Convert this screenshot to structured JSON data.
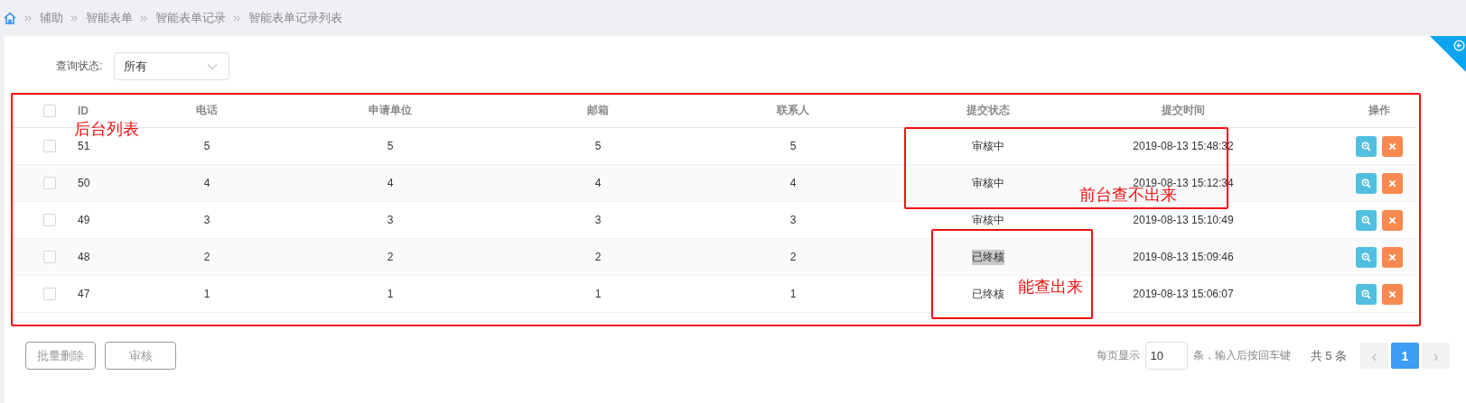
{
  "breadcrumb": [
    "辅助",
    "智能表单",
    "智能表单记录",
    "智能表单记录列表"
  ],
  "filter": {
    "label": "查询状态:",
    "value": "所有"
  },
  "table": {
    "all_checked": false,
    "columns": [
      "ID",
      "电话",
      "申请单位",
      "邮箱",
      "联系人",
      "提交状态",
      "提交时间",
      "操作"
    ],
    "rows": [
      {
        "checked": false,
        "id": "51",
        "phone": "5",
        "unit": "5",
        "email": "5",
        "contact": "5",
        "status": "审核中",
        "status_highlighted": false,
        "time": "2019-08-13 15:48:32"
      },
      {
        "checked": false,
        "id": "50",
        "phone": "4",
        "unit": "4",
        "email": "4",
        "contact": "4",
        "status": "审核中",
        "status_highlighted": false,
        "time": "2019-08-13 15:12:34"
      },
      {
        "checked": false,
        "id": "49",
        "phone": "3",
        "unit": "3",
        "email": "3",
        "contact": "3",
        "status": "审核中",
        "status_highlighted": false,
        "time": "2019-08-13 15:10:49"
      },
      {
        "checked": false,
        "id": "48",
        "phone": "2",
        "unit": "2",
        "email": "2",
        "contact": "2",
        "status": "已终核",
        "status_highlighted": true,
        "time": "2019-08-13 15:09:46"
      },
      {
        "checked": false,
        "id": "47",
        "phone": "1",
        "unit": "1",
        "email": "1",
        "contact": "1",
        "status": "已终核",
        "status_highlighted": false,
        "time": "2019-08-13 15:06:07"
      }
    ]
  },
  "buttons": [
    "批量删除",
    "审核"
  ],
  "pagination": {
    "per_page_label": "每页显示",
    "per_page_value": "10",
    "per_page_hint": "条，输入后按回车键",
    "total": "共 5 条",
    "pages": [
      {
        "kind": "prev",
        "label": "‹",
        "selected": false,
        "disabled": true
      },
      {
        "kind": "page",
        "label": "1",
        "selected": true,
        "disabled": false
      },
      {
        "kind": "next",
        "label": "›",
        "selected": false,
        "disabled": true
      }
    ]
  },
  "annotations": [
    {
      "label": "后台列表",
      "kind": "list"
    },
    {
      "label": "前台查不出来",
      "kind": "hidden"
    },
    {
      "label": "能查出来",
      "kind": "found"
    }
  ]
}
